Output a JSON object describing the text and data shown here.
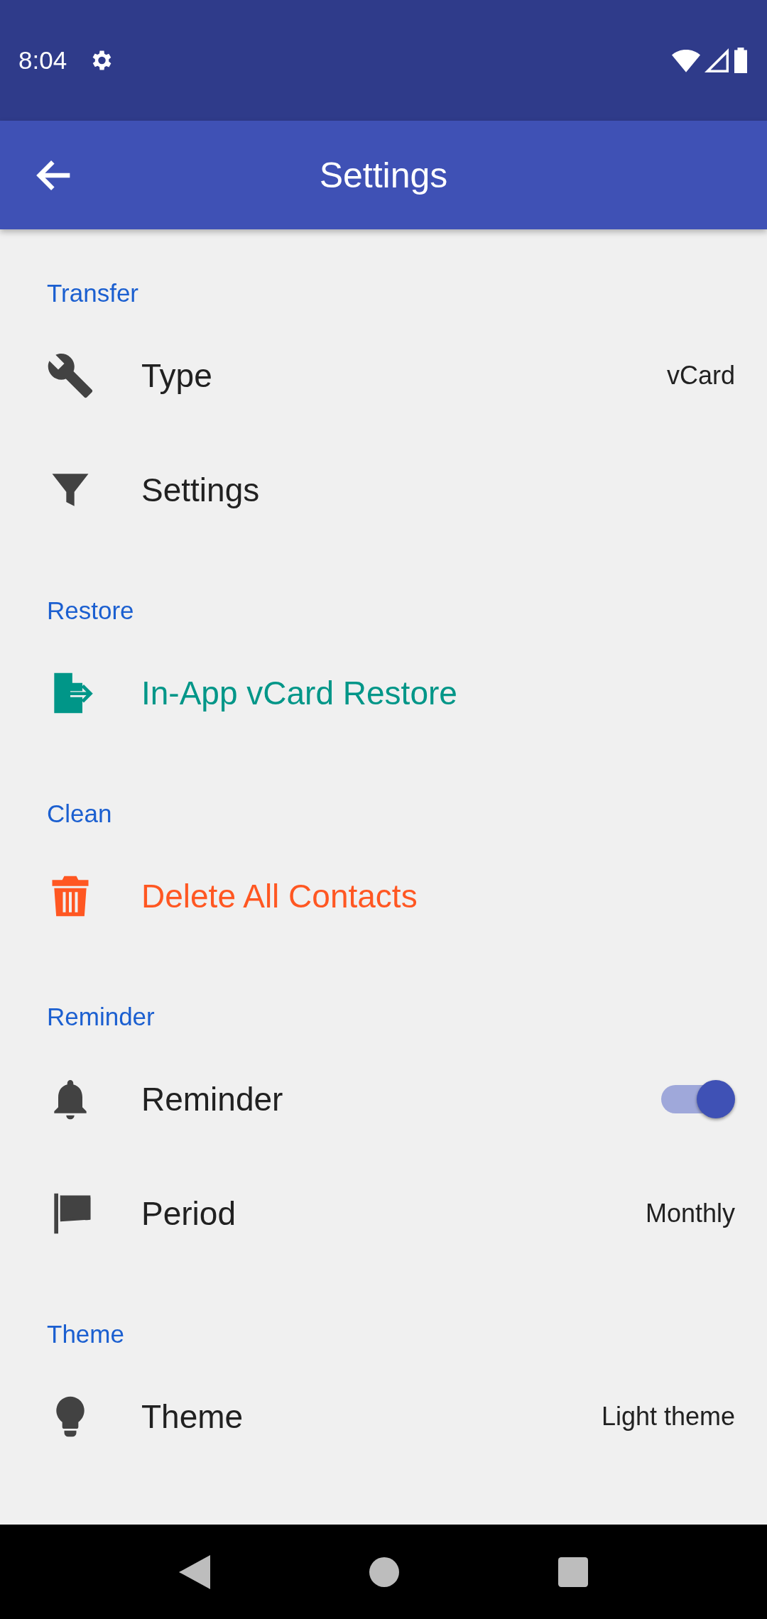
{
  "status_bar": {
    "time": "8:04"
  },
  "app_bar": {
    "title": "Settings"
  },
  "sections": [
    {
      "header": "Transfer",
      "items": [
        {
          "kind": "value",
          "title": "Type",
          "value": "vCard"
        },
        {
          "kind": "plain",
          "title": "Settings"
        }
      ]
    },
    {
      "header": "Restore",
      "items": [
        {
          "kind": "plain",
          "title": "In-App vCard Restore",
          "color": "#009688"
        }
      ]
    },
    {
      "header": "Clean",
      "items": [
        {
          "kind": "plain",
          "title": "Delete All Contacts",
          "color": "#ff5722"
        }
      ]
    },
    {
      "header": "Reminder",
      "items": [
        {
          "kind": "switch",
          "title": "Reminder",
          "on": true
        },
        {
          "kind": "value",
          "title": "Period",
          "value": "Monthly"
        }
      ]
    },
    {
      "header": "Theme",
      "items": [
        {
          "kind": "value",
          "title": "Theme",
          "value": "Light theme"
        }
      ]
    }
  ]
}
